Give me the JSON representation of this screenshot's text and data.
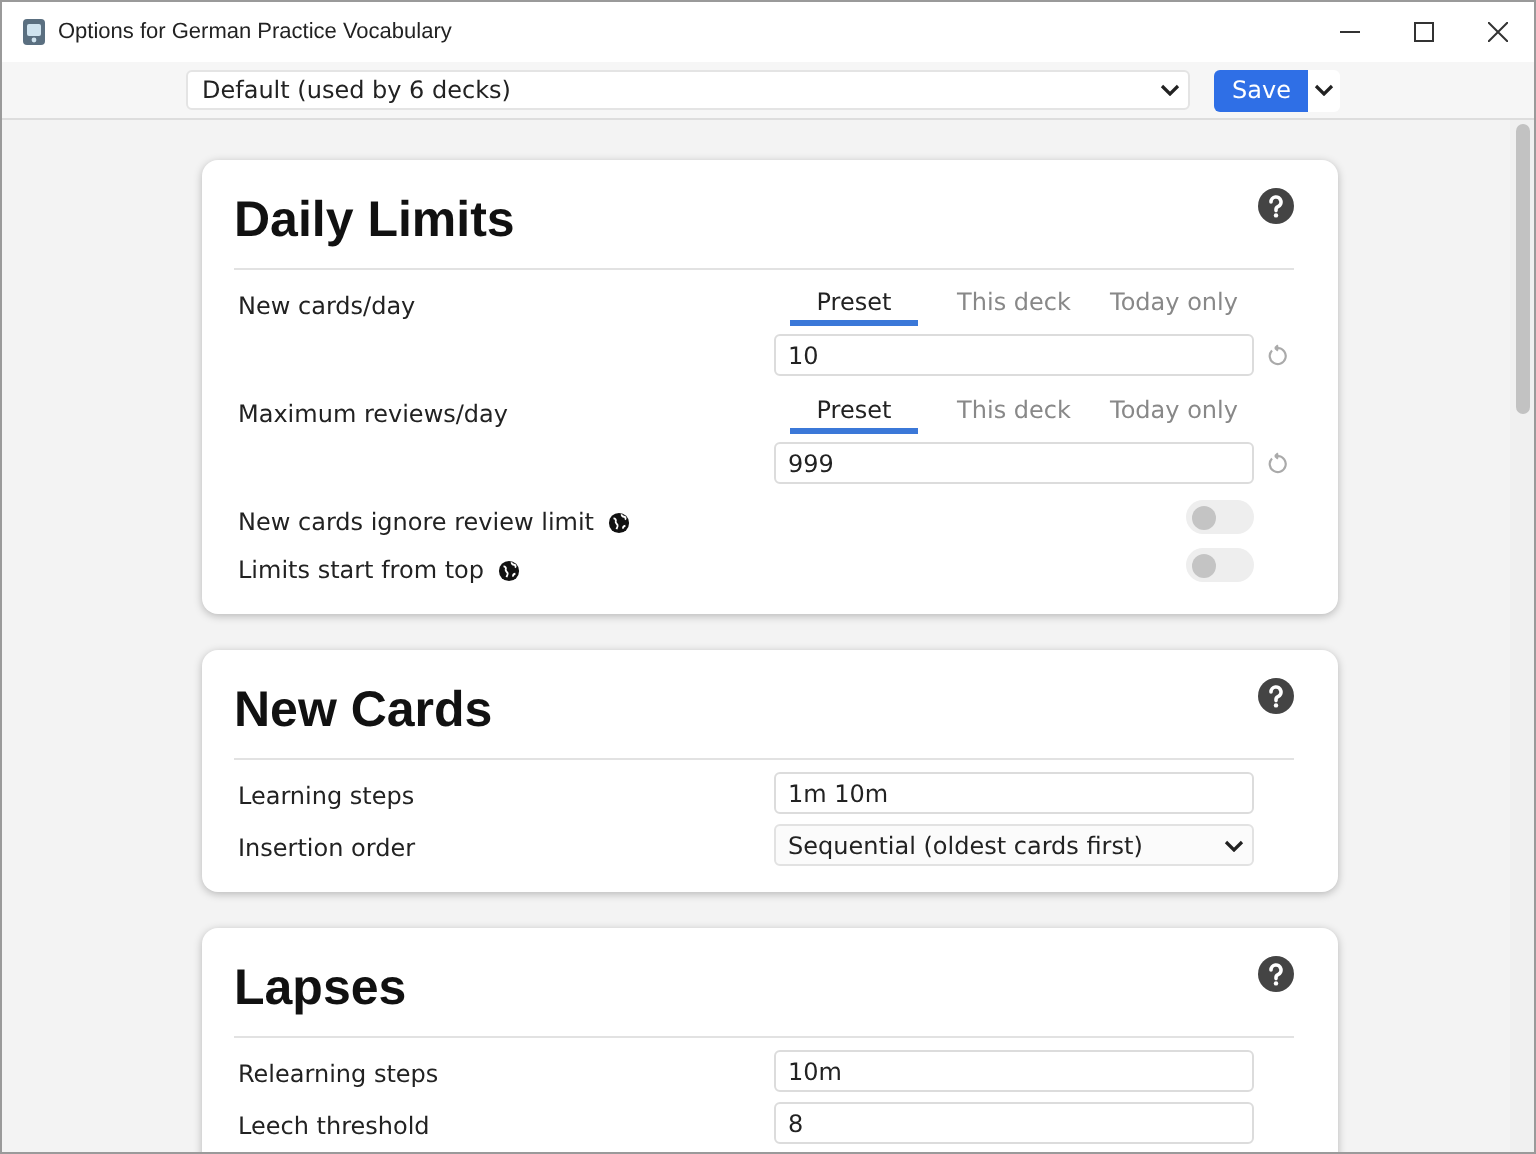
{
  "window": {
    "title": "Options for German Practice Vocabulary"
  },
  "toolbar": {
    "preset": "Default (used by 6 decks)",
    "save": "Save"
  },
  "sections": [
    {
      "title": "Daily Limits",
      "rows": [
        {
          "kind": "tabbed",
          "label": "New cards/day",
          "tabs": [
            {
              "label": "Preset",
              "selected": true
            },
            {
              "label": "This deck",
              "selected": false
            },
            {
              "label": "Today only",
              "selected": false
            }
          ],
          "value": "10"
        },
        {
          "kind": "tabbed",
          "label": "Maximum reviews/day",
          "tabs": [
            {
              "label": "Preset",
              "selected": true
            },
            {
              "label": "This deck",
              "selected": false
            },
            {
              "label": "Today only",
              "selected": false
            }
          ],
          "value": "999"
        },
        {
          "kind": "toggle",
          "label": "New cards ignore review limit",
          "on": false
        },
        {
          "kind": "toggle",
          "label": "Limits start from top",
          "on": false
        }
      ]
    },
    {
      "title": "New Cards",
      "rows": [
        {
          "kind": "text",
          "label": "Learning steps",
          "value": "1m 10m"
        },
        {
          "kind": "select",
          "label": "Insertion order",
          "value": "Sequential (oldest cards first)"
        }
      ]
    },
    {
      "title": "Lapses",
      "rows": [
        {
          "kind": "text",
          "label": "Relearning steps",
          "value": "10m"
        },
        {
          "kind": "text",
          "label": "Leech threshold",
          "value": "8"
        }
      ]
    }
  ]
}
